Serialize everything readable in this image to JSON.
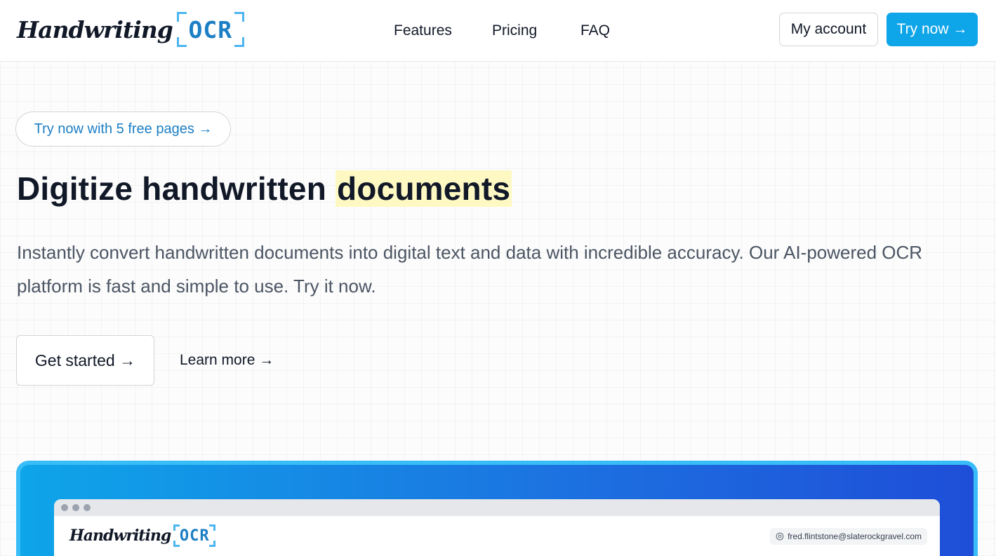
{
  "brand": {
    "script": "Handwriting",
    "mark": "OCR"
  },
  "nav": {
    "features": "Features",
    "pricing": "Pricing",
    "faq": "FAQ"
  },
  "header": {
    "my_account": "My account",
    "try_now": "Try now →"
  },
  "hero": {
    "pill": "Try now with 5 free pages →",
    "headline_pre": "Digitize handwritten ",
    "headline_highlight": "documents",
    "subtext": "Instantly convert handwritten documents into digital text and data with incredible accuracy. Our AI-powered OCR platform is fast and simple to use. Try it now.",
    "get_started": "Get started →",
    "learn_more": "Learn more →"
  },
  "preview": {
    "email": "fred.flintstone@slaterockgravel.com"
  },
  "colors": {
    "accent": "#0ea5e9",
    "brand_blue": "#1c7fc4",
    "highlight": "#fef9c3"
  }
}
